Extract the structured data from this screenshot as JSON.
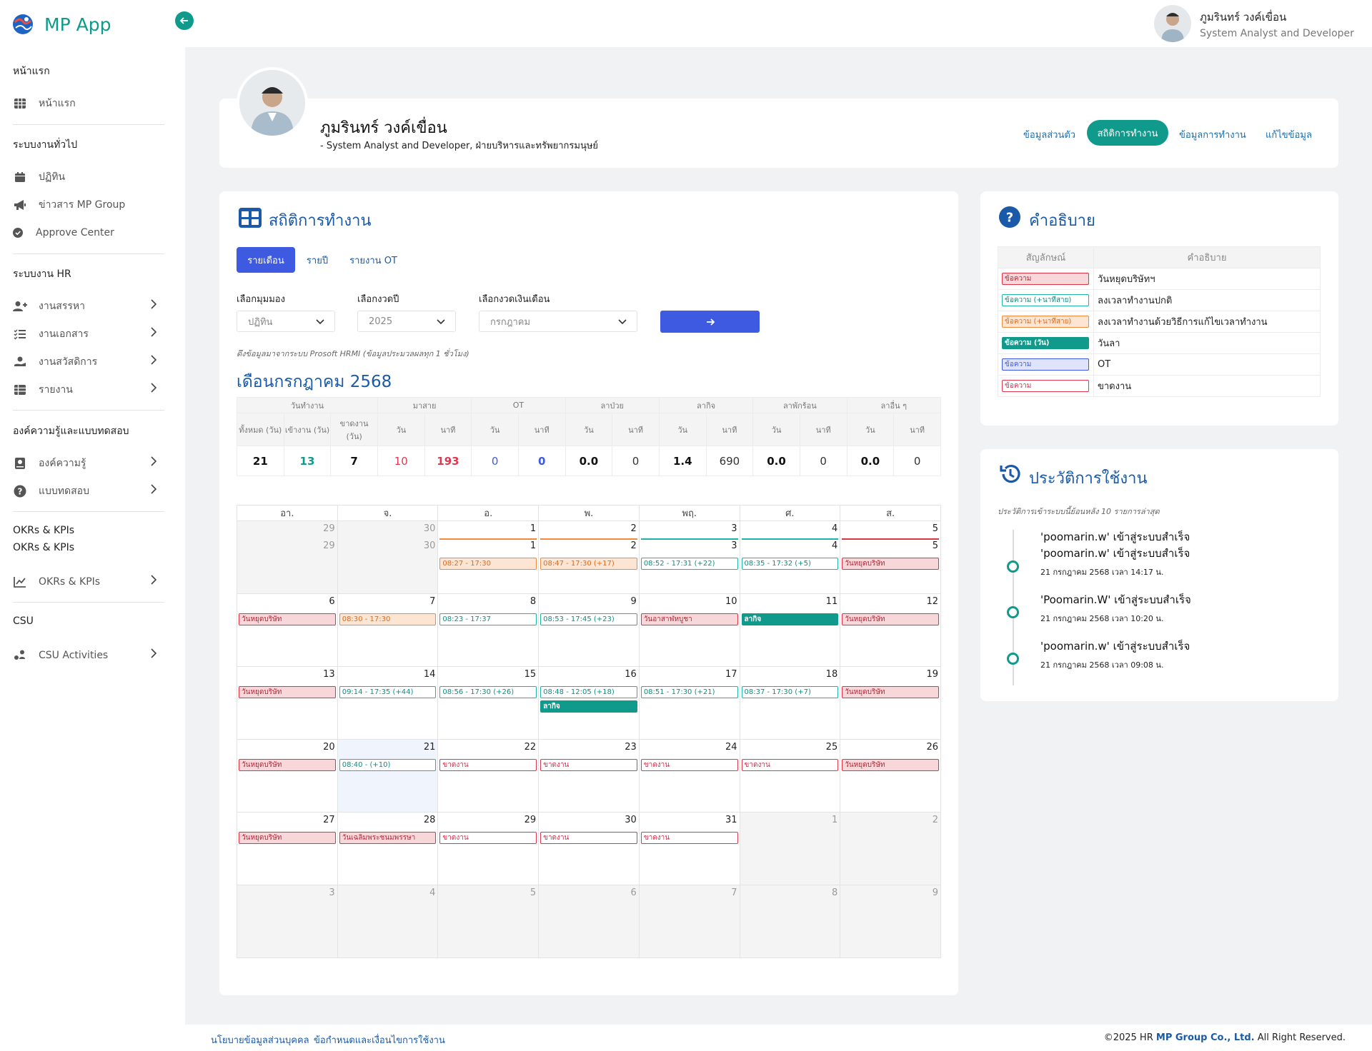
{
  "app": {
    "name": "MP App"
  },
  "user": {
    "name": "ภูมรินทร์ วงค์เขื่อน",
    "role": "System Analyst and Developer"
  },
  "sidebar": {
    "sections": [
      {
        "title": "หน้าแรก",
        "items": [
          {
            "label": "หน้าแรก",
            "icon": "table-icon"
          }
        ]
      },
      {
        "title": "ระบบงานทั่วไป",
        "items": [
          {
            "label": "ปฏิทิน",
            "icon": "calendar-icon"
          },
          {
            "label": "ข่าวสาร MP Group",
            "icon": "megaphone-icon"
          },
          {
            "label": "Approve Center",
            "icon": "check-circle-icon"
          }
        ]
      },
      {
        "title": "ระบบงาน HR",
        "items": [
          {
            "label": "งานสรรหา",
            "icon": "user-plus-icon"
          },
          {
            "label": "งานเอกสาร",
            "icon": "list-check-icon"
          },
          {
            "label": "งานสวัสดิการ",
            "icon": "hand-heart-icon"
          },
          {
            "label": "รายงาน",
            "icon": "table-icon"
          }
        ]
      },
      {
        "title": "องค์ความรู้และแบบทดสอบ",
        "items": [
          {
            "label": "องค์ความรู้",
            "icon": "book-icon"
          },
          {
            "label": "แบบทดสอบ",
            "icon": "question-circle-icon"
          }
        ]
      },
      {
        "title": "OKRs & KPIs",
        "title2": "OKRs & KPIs",
        "items": [
          {
            "label": "OKRs & KPIs",
            "icon": "chart-line-icon"
          }
        ]
      },
      {
        "title": "CSU",
        "items": [
          {
            "label": "CSU Activities",
            "icon": "people-icon"
          }
        ]
      }
    ]
  },
  "profile": {
    "name": "ภูมรินทร์ วงค์เขื่อน",
    "subtitle": "- System Analyst and Developer, ฝ่ายบริหารและทรัพยากรมนุษย์",
    "tabs": [
      "ข้อมูลส่วนตัว",
      "สถิติการทำงาน",
      "ข้อมูลการทำงาน",
      "แก้ไขข้อมูล"
    ]
  },
  "stats": {
    "title": "สถิติการทำงาน",
    "tabs": [
      "รายเดือน",
      "รายปี",
      "รายงาน OT"
    ],
    "filters": [
      {
        "label": "เลือกมุมมอง",
        "value": "ปฏิทิน"
      },
      {
        "label": "เลือกงวดปี",
        "value": "2025"
      },
      {
        "label": "เลือกงวดเงินเดือน",
        "value": "กรกฎาคม"
      }
    ],
    "note": "ดึงข้อมูลมาจากระบบ Prosoft HRMI (ข้อมูลประมวลผลทุก 1 ชั่วโมง)",
    "month_title": "เดือนกรกฎาคม 2568",
    "summary": {
      "groups": [
        "วันทำงาน",
        "มาสาย",
        "OT",
        "ลาป่วย",
        "ลากิจ",
        "ลาพักร้อน",
        "ลาอื่น ๆ"
      ],
      "subheaders": [
        "ทั้งหมด (วัน)",
        "เข้างาน (วัน)",
        "ขาดงาน (วัน)",
        "วัน",
        "นาที",
        "วัน",
        "นาที",
        "วัน",
        "นาที",
        "วัน",
        "นาที",
        "วัน",
        "นาที",
        "วัน",
        "นาที"
      ],
      "values": [
        "21",
        "13",
        "7",
        "10",
        "193",
        "0",
        "0",
        "0.0",
        "0",
        "1.4",
        "690",
        "0.0",
        "0",
        "0.0",
        "0"
      ],
      "colors": [
        "#111",
        "#0f9a8c",
        "#111",
        "#e0384f",
        "#e0384f",
        "#3d5ae0",
        "#3d5ae0",
        "#111",
        "#333",
        "#111",
        "#333",
        "#111",
        "#333",
        "#111",
        "#333"
      ],
      "bold": [
        true,
        true,
        true,
        false,
        true,
        false,
        true,
        true,
        false,
        true,
        false,
        true,
        false,
        true,
        false
      ]
    },
    "calendar": {
      "weekdays": [
        "อา.",
        "จ.",
        "อ.",
        "พ.",
        "พฤ.",
        "ศ.",
        "ส."
      ],
      "weeks": [
        [
          {
            "d": "29",
            "d2": "29",
            "out": true
          },
          {
            "d": "30",
            "d2": "30",
            "out": true
          },
          {
            "d": "1",
            "d2": "1",
            "line": "#f08a3e",
            "ev": [
              {
                "t": "08:27 - 17:30",
                "c": "late"
              }
            ]
          },
          {
            "d": "2",
            "d2": "2",
            "line": "#f08a3e",
            "ev": [
              {
                "t": "08:47 - 17:30 (+17)",
                "c": "late"
              }
            ]
          },
          {
            "d": "3",
            "d2": "3",
            "line": "#20b3a6",
            "ev": [
              {
                "t": "08:52 - 17:31 (+22)",
                "c": "normal"
              }
            ]
          },
          {
            "d": "4",
            "d2": "4",
            "line": "#20b3a6",
            "ev": [
              {
                "t": "08:35 - 17:32 (+5)",
                "c": "normal"
              }
            ]
          },
          {
            "d": "5",
            "d2": "5",
            "line": "#dc3545",
            "ev": [
              {
                "t": "วันหยุดบริษัท",
                "c": "holiday"
              }
            ]
          }
        ],
        [
          {
            "d": "6",
            "ev": [
              {
                "t": "วันหยุดบริษัท",
                "c": "holiday"
              }
            ]
          },
          {
            "d": "7",
            "ev": [
              {
                "t": "08:30 - 17:30",
                "c": "late"
              }
            ]
          },
          {
            "d": "8",
            "ev": [
              {
                "t": "08:23 - 17:37",
                "c": "normal"
              }
            ]
          },
          {
            "d": "9",
            "ev": [
              {
                "t": "08:53 - 17:45 (+23)",
                "c": "normal"
              }
            ]
          },
          {
            "d": "10",
            "ev": [
              {
                "t": "วันอาสาฬหบูชา",
                "c": "holiday"
              }
            ]
          },
          {
            "d": "11",
            "ev": [
              {
                "t": "ลากิจ",
                "c": "leave"
              }
            ]
          },
          {
            "d": "12",
            "ev": [
              {
                "t": "วันหยุดบริษัท",
                "c": "holiday"
              }
            ]
          }
        ],
        [
          {
            "d": "13",
            "ev": [
              {
                "t": "วันหยุดบริษัท",
                "c": "holiday"
              }
            ]
          },
          {
            "d": "14",
            "ev": [
              {
                "t": "09:14 - 17:35 (+44)",
                "c": "normal"
              }
            ]
          },
          {
            "d": "15",
            "ev": [
              {
                "t": "08:56 - 17:30 (+26)",
                "c": "normal"
              }
            ]
          },
          {
            "d": "16",
            "ev": [
              {
                "t": "08:48 - 12:05 (+18)",
                "c": "normal"
              },
              {
                "t": "ลากิจ",
                "c": "leave"
              }
            ]
          },
          {
            "d": "17",
            "ev": [
              {
                "t": "08:51 - 17:30 (+21)",
                "c": "normal"
              }
            ]
          },
          {
            "d": "18",
            "ev": [
              {
                "t": "08:37 - 17:30 (+7)",
                "c": "normal"
              }
            ]
          },
          {
            "d": "19",
            "ev": [
              {
                "t": "วันหยุดบริษัท",
                "c": "holiday"
              }
            ]
          }
        ],
        [
          {
            "d": "20",
            "ev": [
              {
                "t": "วันหยุดบริษัท",
                "c": "holiday"
              }
            ]
          },
          {
            "d": "21",
            "today": true,
            "ev": [
              {
                "t": "08:40 - (+10)",
                "c": "normal"
              }
            ]
          },
          {
            "d": "22",
            "ev": [
              {
                "t": "ขาดงาน",
                "c": "absent"
              }
            ]
          },
          {
            "d": "23",
            "ev": [
              {
                "t": "ขาดงาน",
                "c": "absent"
              }
            ]
          },
          {
            "d": "24",
            "ev": [
              {
                "t": "ขาดงาน",
                "c": "absent"
              }
            ]
          },
          {
            "d": "25",
            "ev": [
              {
                "t": "ขาดงาน",
                "c": "absent"
              }
            ]
          },
          {
            "d": "26",
            "ev": [
              {
                "t": "วันหยุดบริษัท",
                "c": "holiday"
              }
            ]
          }
        ],
        [
          {
            "d": "27",
            "ev": [
              {
                "t": "วันหยุดบริษัท",
                "c": "holiday"
              }
            ]
          },
          {
            "d": "28",
            "ev": [
              {
                "t": "วันเฉลิมพระชนมพรรษา",
                "c": "holiday"
              }
            ]
          },
          {
            "d": "29",
            "ev": [
              {
                "t": "ขาดงาน",
                "c": "absent"
              }
            ]
          },
          {
            "d": "30",
            "ev": [
              {
                "t": "ขาดงาน",
                "c": "absent"
              }
            ]
          },
          {
            "d": "31",
            "ev": [
              {
                "t": "ขาดงาน",
                "c": "absent"
              }
            ]
          },
          {
            "d": "1",
            "out": true
          },
          {
            "d": "2",
            "out": true
          }
        ],
        [
          {
            "d": "3",
            "out": true
          },
          {
            "d": "4",
            "out": true
          },
          {
            "d": "5",
            "out": true
          },
          {
            "d": "6",
            "out": true
          },
          {
            "d": "7",
            "out": true
          },
          {
            "d": "8",
            "out": true
          },
          {
            "d": "9",
            "out": true
          }
        ]
      ]
    }
  },
  "legend": {
    "title": "คำอธิบาย",
    "col1": "สัญลักษณ์",
    "col2": "คำอธิบาย",
    "rows": [
      {
        "chip": "ข้อความ",
        "c": "holiday",
        "desc": "วันหยุดบริษัทฯ"
      },
      {
        "chip": "ข้อความ (+นาทีสาย)",
        "c": "normal",
        "desc": "ลงเวลาทำงานปกติ"
      },
      {
        "chip": "ข้อความ (+นาทีสาย)",
        "c": "late",
        "desc": "ลงเวลาทำงานด้วยวิธีการแก้ไขเวลาทำงาน"
      },
      {
        "chip": "ข้อความ (วัน)",
        "c": "leave",
        "desc": "วันลา"
      },
      {
        "chip": "ข้อความ",
        "c": "ot",
        "desc": "OT"
      },
      {
        "chip": "ข้อความ",
        "c": "absent",
        "desc": "ขาดงาน"
      }
    ]
  },
  "history": {
    "title": "ประวัติการใช้งาน",
    "subtitle": "ประวัติการเข้าระบบนี้ย้อนหลัง 10 รายการล่าสุด",
    "items": [
      {
        "text": "'poomarin.w' เข้าสู่ระบบสำเร็จ",
        "text2": "'poomarin.w' เข้าสู่ระบบสำเร็จ",
        "time": "21 กรกฎาคม 2568 เวลา 14:17 น."
      },
      {
        "text": "'Poomarin.W' เข้าสู่ระบบสำเร็จ",
        "time": "21 กรกฎาคม 2568 เวลา 10:20 น."
      },
      {
        "text": "'poomarin.w' เข้าสู่ระบบสำเร็จ",
        "time": "21 กรกฎาคม 2568 เวลา 09:08 น."
      }
    ]
  },
  "footer": {
    "links": [
      "นโยบายข้อมูลส่วนบุคคล",
      "ข้อกำหนดและเงื่อนไขการใช้งาน"
    ],
    "copy_prefix": "©2025 HR ",
    "copy_brand": "MP Group Co., Ltd.",
    "copy_suffix": " All Right Reserved."
  },
  "colors": {
    "accent": "#0f9a8c",
    "primary": "#3d5ae0",
    "title": "#1a5aa8",
    "danger": "#dc3545",
    "warning": "#f08a3e"
  }
}
